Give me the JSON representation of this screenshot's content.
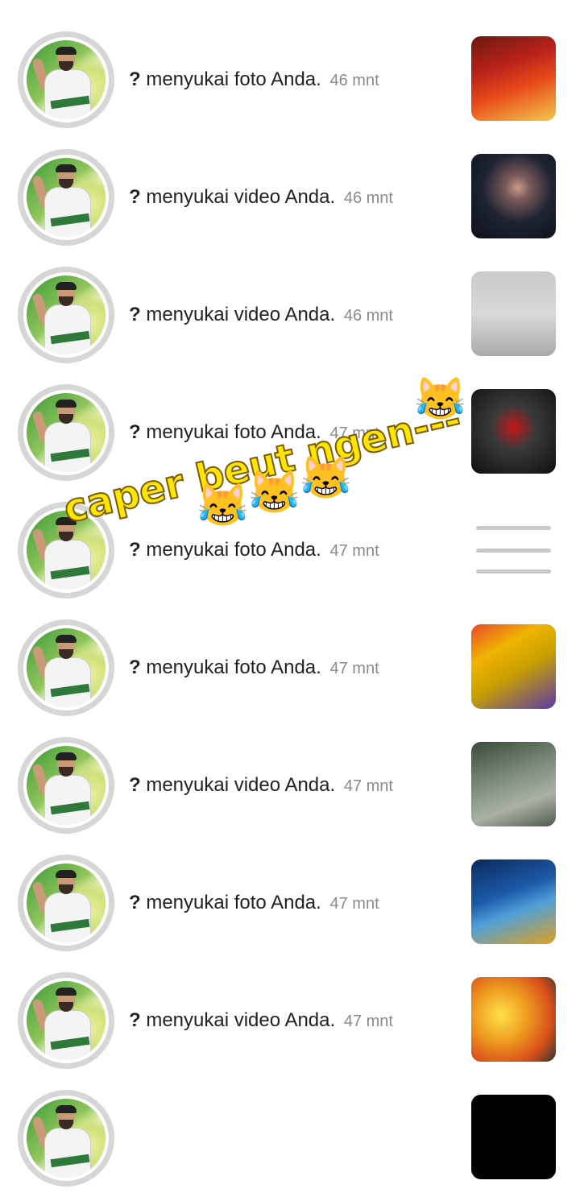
{
  "notifications": [
    {
      "user": "?",
      "action": "menyukai foto Anda.",
      "time": "46 mnt",
      "thumb": "t0"
    },
    {
      "user": "?",
      "action": "menyukai video Anda.",
      "time": "46 mnt",
      "thumb": "t1"
    },
    {
      "user": "?",
      "action": "menyukai video Anda.",
      "time": "46 mnt",
      "thumb": "t2"
    },
    {
      "user": "?",
      "action": "menyukai foto Anda.",
      "time": "47 mnt",
      "thumb": "t3"
    },
    {
      "user": "?",
      "action": "menyukai foto Anda.",
      "time": "47 mnt",
      "thumb": "t4"
    },
    {
      "user": "?",
      "action": "menyukai foto Anda.",
      "time": "47 mnt",
      "thumb": "t5"
    },
    {
      "user": "?",
      "action": "menyukai video Anda.",
      "time": "47 mnt",
      "thumb": "t6"
    },
    {
      "user": "?",
      "action": "menyukai foto Anda.",
      "time": "47 mnt",
      "thumb": "t7"
    },
    {
      "user": "?",
      "action": "menyukai video Anda.",
      "time": "47 mnt",
      "thumb": "t8"
    },
    {
      "user": "",
      "action": "",
      "time": "",
      "thumb": "t9"
    }
  ],
  "sticker": {
    "text": "caper beut ngen---",
    "emoji": "😹"
  }
}
